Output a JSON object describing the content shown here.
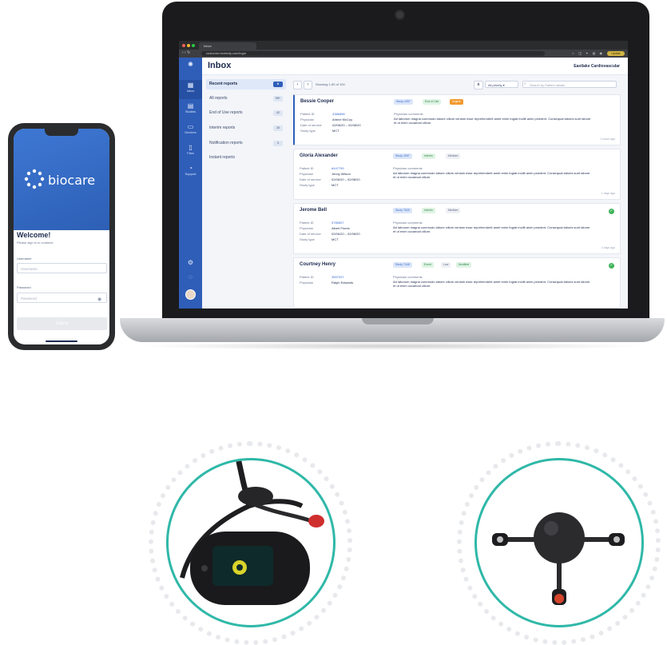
{
  "browser": {
    "tab_title": "Inbox",
    "url": "customer.biotricity.com/login",
    "profile": "Update"
  },
  "app": {
    "nav": [
      {
        "label": "Inbox",
        "icon": "inbox-icon"
      },
      {
        "label": "Studies",
        "icon": "studies-icon"
      },
      {
        "label": "Devices",
        "icon": "devices-icon"
      },
      {
        "label": "Files",
        "icon": "files-icon"
      },
      {
        "label": "Support",
        "icon": "support-icon"
      }
    ],
    "title": "Inbox",
    "organization": "Eastlake Cardiovascular",
    "filters": [
      {
        "label": "Recent reports",
        "count": "8"
      },
      {
        "label": "All reports",
        "count": "99+"
      },
      {
        "label": "End of Use reports",
        "count": "42"
      },
      {
        "label": "Interim reports",
        "count": "15"
      },
      {
        "label": "Notification reports",
        "count": "3"
      },
      {
        "label": "Instant reports",
        "count": ""
      }
    ],
    "toolbar": {
      "showing": "Showing 1-50 of 100",
      "priority": "All priority",
      "search_placeholder": "Search by Patient details"
    },
    "field_labels": {
      "patient_id": "Patient ID",
      "physician": "Physician",
      "date_of_service": "Date of service",
      "study_type": "Study type",
      "physician_comments": "Physician comments"
    },
    "comment_text": "Ad laborum magna commodo labore cillum veniam esse reprehenderit amet enim fugiat mollit anim proident. Consequat laboris sunt labore et ut enim occaecat cillum.",
    "reports": [
      {
        "name": "Bessie Cooper",
        "patient_id": "4386658",
        "physician": "Arlene McCoy",
        "date_of_service": "02/06/20 – 02/08/20",
        "study_type": "MCT",
        "tags": [
          {
            "label": "Study 4357",
            "bg": "#dbe6f8",
            "fg": "#3b6ed1"
          },
          {
            "label": "End of Use",
            "bg": "#dff3e4",
            "fg": "#2f8a4a"
          },
          {
            "label": "Urgent",
            "bg": "#f29a2e",
            "fg": "#ffffff"
          }
        ],
        "time": "1 hours ago",
        "done": false
      },
      {
        "name": "Gloria Alexander",
        "patient_id": "6447799",
        "physician": "Jenny Wilson",
        "date_of_service": "02/06/20 – 02/08/20",
        "study_type": "MCT",
        "tags": [
          {
            "label": "Study 4357",
            "bg": "#dbe6f8",
            "fg": "#3b6ed1"
          },
          {
            "label": "Interim",
            "bg": "#dff3e4",
            "fg": "#2f8a4a"
          },
          {
            "label": "Medium",
            "bg": "#eef0f4",
            "fg": "#56637f"
          }
        ],
        "time": "1 days ago",
        "done": false
      },
      {
        "name": "Jerome Bell",
        "patient_id": "5785657",
        "physician": "Albert Flores",
        "date_of_service": "02/06/20 – 02/08/20",
        "study_type": "MCT",
        "tags": [
          {
            "label": "Study 7849",
            "bg": "#dbe6f8",
            "fg": "#3b6ed1"
          },
          {
            "label": "Interim",
            "bg": "#dff3e4",
            "fg": "#2f8a4a"
          },
          {
            "label": "Medium",
            "bg": "#eef0f4",
            "fg": "#56637f"
          }
        ],
        "time": "2 days ago",
        "done": true
      },
      {
        "name": "Courtney Henry",
        "patient_id": "3557097",
        "physician": "Ralph Edwards",
        "date_of_service": "",
        "study_type": "",
        "tags": [
          {
            "label": "Study 7448",
            "bg": "#dbe6f8",
            "fg": "#3b6ed1"
          },
          {
            "label": "Event",
            "bg": "#dff3e4",
            "fg": "#2f8a4a"
          },
          {
            "label": "Low",
            "bg": "#eef0f4",
            "fg": "#56637f"
          },
          {
            "label": "Modified",
            "bg": "#dff3e4",
            "fg": "#2f8a4a"
          }
        ],
        "time": "",
        "done": true
      }
    ]
  },
  "phone": {
    "brand": "biocare",
    "welcome": "Welcome!",
    "subtitle": "Please sign in to continue",
    "username_label": "Username",
    "username_placeholder": "Username",
    "password_label": "Password",
    "password_placeholder": "Password",
    "submit": "Submit"
  },
  "colors": {
    "brand_blue": "#2f5eb8",
    "accent_teal": "#2fb8a8",
    "urgent_orange": "#f29a2e",
    "success_green": "#3fb35a"
  }
}
